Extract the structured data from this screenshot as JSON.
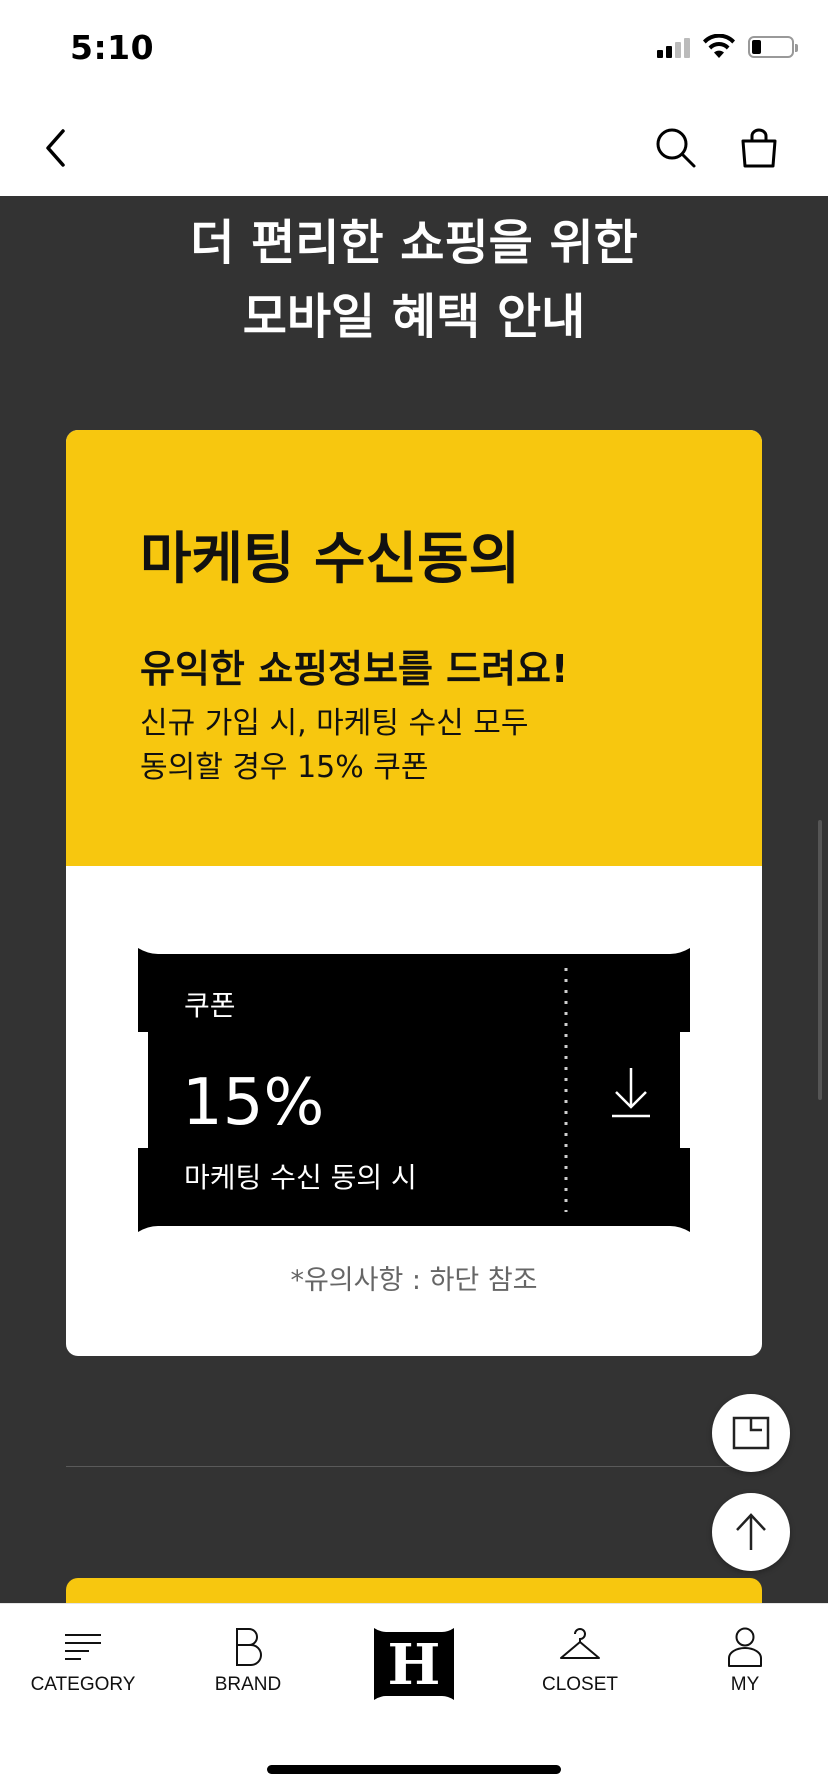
{
  "status_bar": {
    "time": "5:10"
  },
  "header": {
    "title_lines": [
      "더 편리한 쇼핑을 위한",
      "모바일 혜택 안내"
    ]
  },
  "marketing_card": {
    "title": "마케팅 수신동의",
    "subtitle": "유익한 쇼핑정보를 드려요!",
    "description_lines": [
      "신규 가입 시, 마케팅 수신 모두",
      "동의할 경우 15% 쿠폰"
    ],
    "coupon": {
      "label": "쿠폰",
      "value": "15%",
      "condition": "마케팅 수신 동의 시"
    },
    "note": "*유의사항 : 하단 참조"
  },
  "tab_bar": {
    "tabs": [
      {
        "label": "CATEGORY",
        "icon": "category-icon"
      },
      {
        "label": "BRAND",
        "icon": "brand-icon"
      },
      {
        "label": "",
        "icon": "home-logo-icon"
      },
      {
        "label": "CLOSET",
        "icon": "hanger-icon"
      },
      {
        "label": "MY",
        "icon": "person-icon"
      }
    ]
  },
  "colors": {
    "background": "#333333",
    "accent_yellow": "#f7c70f",
    "coupon_black": "#000000"
  }
}
